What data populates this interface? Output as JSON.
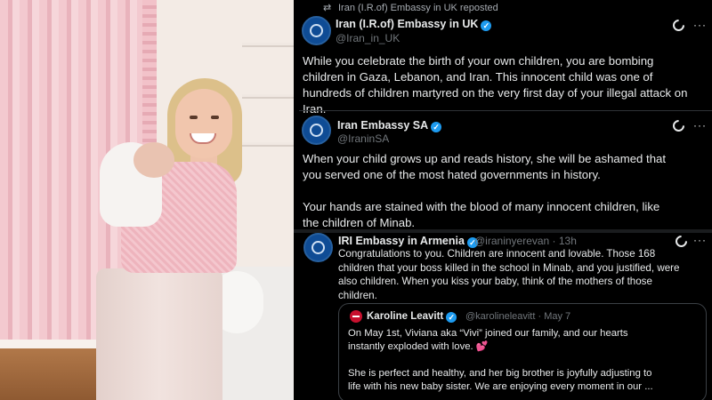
{
  "repost_banner": {
    "text": "Iran (I.R.of) Embassy in UK reposted",
    "icon": "repost-icon"
  },
  "tweets": [
    {
      "name": "Iran (I.R.of) Embassy in UK",
      "handle": "@Iran_in_UK",
      "text": "While you celebrate the birth of your own children, you are bombing\nchildren in Gaza, Lebanon, and Iran. This innocent child was one of\nhundreds of children martyred on the very first day of your illegal attack on\nIran."
    },
    {
      "name": "Iran Embassy SA",
      "handle": "@IraninSA",
      "text": "When your child grows up and reads history, she will be ashamed that\nyou served one of the most hated governments in history.\n\nYour hands are stained with the blood of many innocent children, like\nthe children of Minab."
    },
    {
      "name": "IRI Embassy in Armenia",
      "handle": "@iraninyerevan · 13h",
      "text": "Congratulations to you. Children are innocent and lovable. Those 168\nchildren that your boss killed in the school in Minab, and you justified, were\nalso children. When you kiss your baby, think of the mothers of those\nchildren."
    }
  ],
  "quoted_tweet": {
    "name": "Karoline Leavitt",
    "handle": "@karolineleavitt · May 7",
    "line1": "On May 1st, Viviana aka “Vivi” joined our family, and our hearts",
    "line2": "instantly exploded with love.",
    "heart": "💕",
    "line3": "She is perfect and healthy, and her big brother is joyfully adjusting to\nlife with his new baby sister. We are enjoying every moment in our ..."
  },
  "ui": {
    "more_glyph": "···",
    "verified_glyph": "✓"
  },
  "colors": {
    "background": "#000000",
    "text": "#e7e9ea",
    "muted": "#71767b",
    "verified": "#1d9bf0",
    "avatar": "#0f4c95"
  }
}
